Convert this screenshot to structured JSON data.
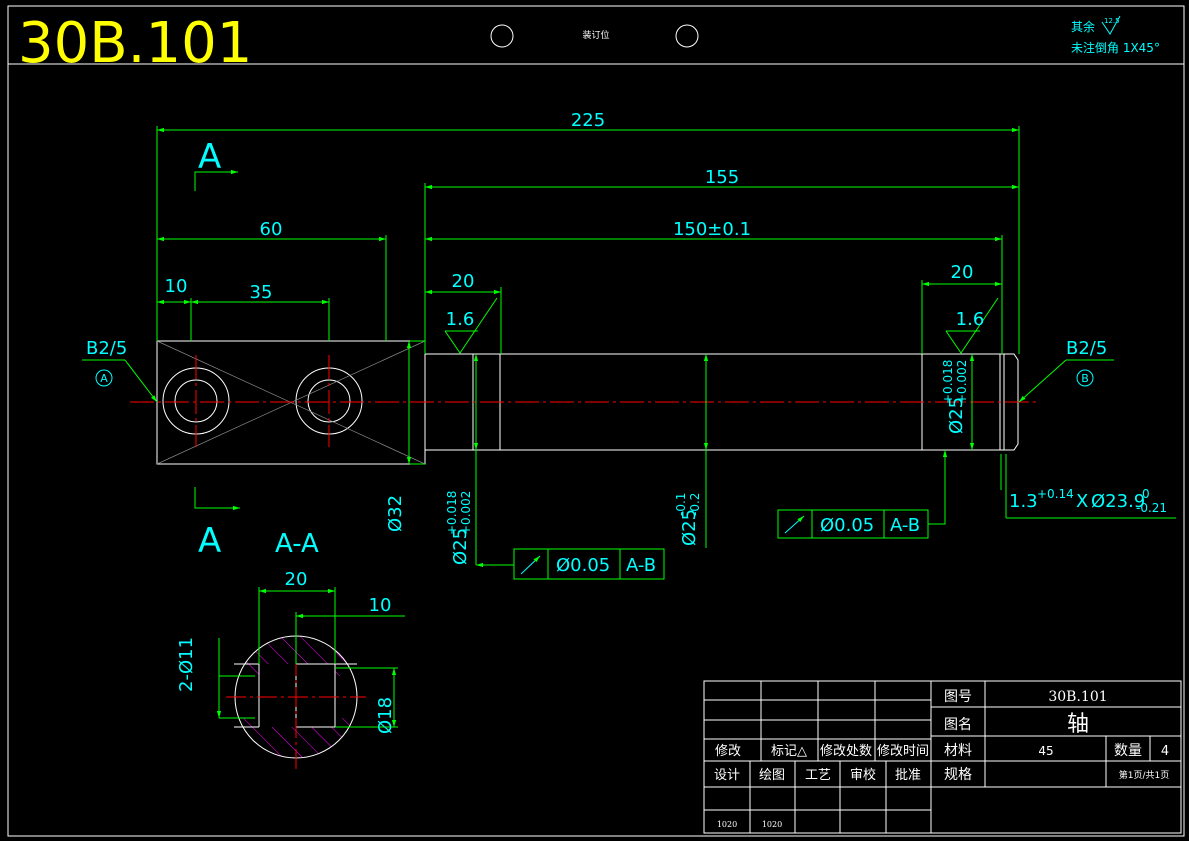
{
  "drawing_number_big": "30B.101",
  "binding_label": "装订位",
  "roughness_note": {
    "line1": "其余",
    "roughness_value": "12.5",
    "line2": "未注倒角 1X45°"
  },
  "section_marks": {
    "top": "A",
    "bottom": "A",
    "section_title": "A-A"
  },
  "dims": {
    "overall": "225",
    "d155": "155",
    "d150": "150±0.1",
    "d60": "60",
    "d10": "10",
    "d35": "35",
    "d20_left": "20",
    "d20_right": "20",
    "rough_left": "1.6",
    "rough_right": "1.6",
    "dia32": "Ø32",
    "dia25_left": "Ø25",
    "dia25_left_tol_up": "+0.018",
    "dia25_left_tol_lo": "+0.002",
    "dia25_mid": "Ø25",
    "dia25_mid_tol_up": "-0.1",
    "dia25_mid_tol_lo": "-0.2",
    "dia25_right": "Ø25",
    "dia25_right_tol_up": "+0.018",
    "dia25_right_tol_lo": "+0.002",
    "groove": "1.3",
    "groove_tol": "+0.14",
    "groove_x": "X",
    "groove_dia": "Ø23.9",
    "groove_dia_tol_up": "0",
    "groove_dia_tol_lo": "-0.21",
    "sec_20": "20",
    "sec_10": "10",
    "sec_holes": "2-Ø11",
    "sec_18": "Ø18"
  },
  "datums": {
    "left_label": "B2/5",
    "left_letter": "A",
    "right_label": "B2/5",
    "right_letter": "B"
  },
  "tolerance_frames": [
    {
      "symbol": "↗",
      "value": "Ø0.05",
      "datum": "A-B"
    },
    {
      "symbol": "↗",
      "value": "Ø0.05",
      "datum": "A-B"
    }
  ],
  "title_block": {
    "drawing_no_label": "图号",
    "drawing_no": "30B.101",
    "name_label": "图名",
    "name": "轴",
    "material_label": "材料",
    "material": "45",
    "qty_label": "数量",
    "qty": "4",
    "spec_label": "规格",
    "page": "第1页/共1页",
    "rev_headers": [
      "修改",
      "标记△",
      "修改处数",
      "修改时间"
    ],
    "sign_headers": [
      "设计",
      "绘图",
      "工艺",
      "审校",
      "批准"
    ],
    "sign_values": [
      "1020",
      "1020",
      "",
      "",
      ""
    ]
  },
  "colors": {
    "background": "#000000",
    "frame": "#ffffff",
    "dimension": "#00ff00",
    "text": "#00ffff",
    "center": "#ff0000",
    "hatch": "#ff00ff",
    "title_yellow": "#ffff00"
  }
}
